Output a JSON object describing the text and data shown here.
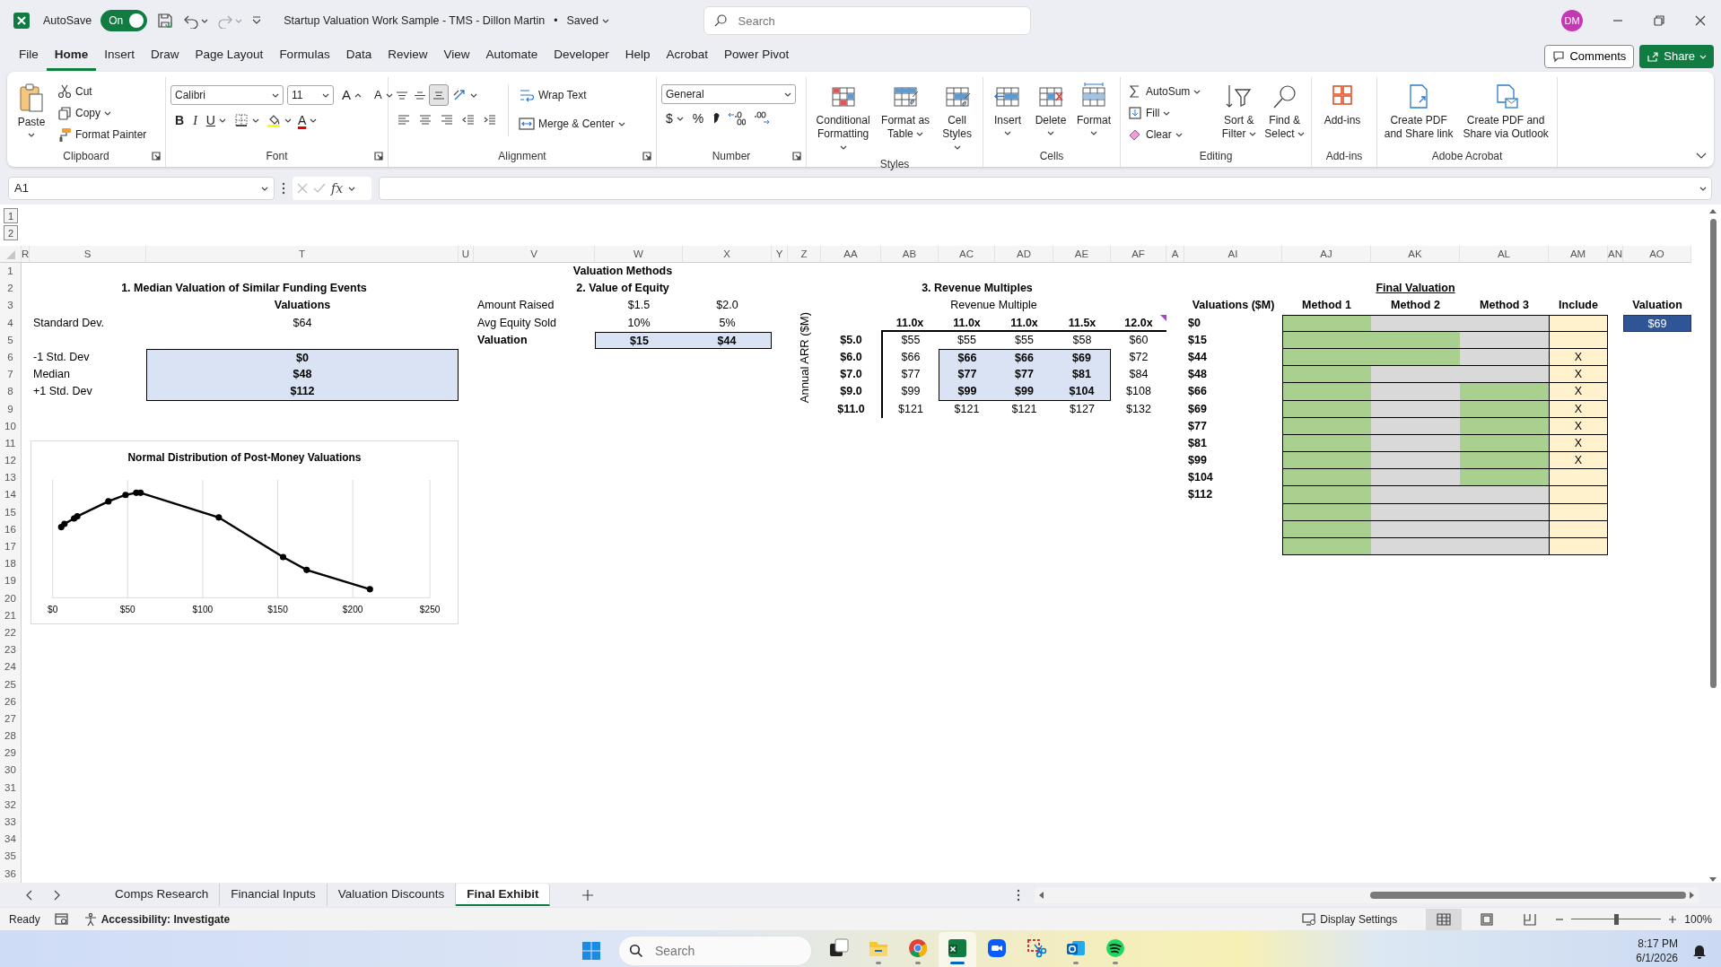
{
  "title_bar": {
    "autosave_label": "AutoSave",
    "autosave": {
      "on": true,
      "label": "On"
    },
    "document_title": "Startup Valuation Work Sample - TMS - Dillon Martin",
    "separator": "•",
    "save_status": "Saved",
    "search_placeholder": "Search",
    "user_initials": "DM"
  },
  "menu_tabs": [
    {
      "label": "File",
      "selected": false
    },
    {
      "label": "Home",
      "selected": true
    },
    {
      "label": "Insert",
      "selected": false
    },
    {
      "label": "Draw",
      "selected": false
    },
    {
      "label": "Page Layout",
      "selected": false
    },
    {
      "label": "Formulas",
      "selected": false
    },
    {
      "label": "Data",
      "selected": false
    },
    {
      "label": "Review",
      "selected": false
    },
    {
      "label": "View",
      "selected": false
    },
    {
      "label": "Automate",
      "selected": false
    },
    {
      "label": "Developer",
      "selected": false
    },
    {
      "label": "Help",
      "selected": false
    },
    {
      "label": "Acrobat",
      "selected": false
    },
    {
      "label": "Power Pivot",
      "selected": false
    }
  ],
  "comments_button": "Comments",
  "share_button": "Share",
  "ribbon": {
    "clipboard": {
      "label": "Clipboard",
      "paste": "Paste",
      "cut": "Cut",
      "copy": "Copy",
      "format_painter": "Format Painter"
    },
    "font": {
      "label": "Font",
      "font_name": "Calibri",
      "font_size": "11",
      "grow": "A",
      "shrink": "A",
      "bold": "B",
      "italic": "I",
      "underline": "U",
      "font_color": "A"
    },
    "alignment": {
      "label": "Alignment",
      "vertical_alignment": [
        {
          "selected": false
        },
        {
          "selected": false
        },
        {
          "selected": true
        }
      ],
      "wrap_text": "Wrap Text",
      "merge_center": "Merge & Center"
    },
    "number": {
      "label": "Number",
      "format": "General",
      "currency": "$",
      "percent": "%"
    },
    "styles": {
      "label": "Styles",
      "buttons": [
        "Conditional Formatting",
        "Format as Table",
        "Cell Styles"
      ]
    },
    "cells": {
      "label": "Cells",
      "buttons": [
        "Insert",
        "Delete",
        "Format"
      ]
    },
    "editing": {
      "label": "Editing",
      "autosum": "AutoSum",
      "fill": "Fill",
      "clear": "Clear",
      "buttons": [
        "Sort & Filter",
        "Find & Select"
      ]
    },
    "addins": {
      "label": "Add-ins",
      "buttons": [
        "Add-ins"
      ]
    },
    "acrobat": {
      "label": "Adobe Acrobat",
      "buttons": [
        "Create PDF and Share link",
        "Create PDF and Share via Outlook"
      ]
    }
  },
  "formula_bar": {
    "name_box": "A1",
    "function_button": "fx"
  },
  "outline_levels": [
    "1",
    "2"
  ],
  "column_headers": [
    "R",
    "S",
    "T",
    "U",
    "V",
    "W",
    "X",
    "Y",
    "Z",
    "AA",
    "AB",
    "AC",
    "AD",
    "AE",
    "AF",
    "A",
    "AI",
    "AJ",
    "AK",
    "AL",
    "AM",
    "AN",
    "AO"
  ],
  "row_headers": [
    "1",
    "2",
    "3",
    "4",
    "5",
    "6",
    "7",
    "8",
    "9",
    "10",
    "11",
    "12",
    "13",
    "14",
    "15",
    "16",
    "17",
    "18",
    "19",
    "20",
    "21",
    "22",
    "23",
    "24",
    "25",
    "26",
    "27",
    "28",
    "29",
    "30",
    "31",
    "32",
    "33",
    "34",
    "35",
    "36"
  ],
  "sheet": {
    "section_title": "Valuation Methods",
    "median": {
      "title": "1. Median Valuation of Similar Funding Events",
      "column_header": "Valuations",
      "std_dev_label": "Standard Dev.",
      "std_dev_value": "$64",
      "rows": [
        {
          "label": "-1 Std. Dev",
          "value": "$0",
          "highlighted": true
        },
        {
          "label": "Median",
          "value": "$48",
          "highlighted": true
        },
        {
          "label": "+1 Std. Dev",
          "value": "$112",
          "highlighted": true
        }
      ]
    },
    "chart": {
      "title": "Normal Distribution of Post-Money Valuations",
      "x_tick_labels": [
        "$0",
        "$50",
        "$100",
        "$150",
        "$200",
        "$250"
      ]
    },
    "equity": {
      "title": "2. Value of Equity",
      "rows": [
        {
          "label": "Amount Raised",
          "values": [
            "$1.5",
            "$2.0"
          ],
          "highlighted": false
        },
        {
          "label": "Avg Equity Sold",
          "values": [
            "10%",
            "5%"
          ],
          "highlighted": false
        },
        {
          "label": "Valuation",
          "values": [
            "$15",
            "$44"
          ],
          "highlighted": true
        }
      ]
    },
    "revenue": {
      "title": "3. Revenue Multiples",
      "column_title": "Revenue Multiple",
      "row_title": "Annual ARR ($M)",
      "has_comment": true,
      "multiples": [
        "11.0x",
        "11.0x",
        "11.0x",
        "11.5x",
        "12.0x"
      ],
      "rows": [
        {
          "arr": "$5.0",
          "values": [
            "$55",
            "$55",
            "$55",
            "$58",
            "$60"
          ],
          "highlighted": [
            false,
            false,
            false,
            false,
            false
          ]
        },
        {
          "arr": "$6.0",
          "values": [
            "$66",
            "$66",
            "$66",
            "$69",
            "$72"
          ],
          "highlighted": [
            false,
            true,
            true,
            true,
            false
          ]
        },
        {
          "arr": "$7.0",
          "values": [
            "$77",
            "$77",
            "$77",
            "$81",
            "$84"
          ],
          "highlighted": [
            false,
            true,
            true,
            true,
            false
          ]
        },
        {
          "arr": "$9.0",
          "values": [
            "$99",
            "$99",
            "$99",
            "$104",
            "$108"
          ],
          "highlighted": [
            false,
            true,
            true,
            true,
            false
          ]
        },
        {
          "arr": "$11.0",
          "values": [
            "$121",
            "$121",
            "$121",
            "$127",
            "$132"
          ],
          "highlighted": [
            false,
            false,
            false,
            false,
            false
          ]
        }
      ]
    },
    "final": {
      "title": "Final Valuation",
      "headers": [
        "Valuations ($M)",
        "Method 1",
        "Method 2",
        "Method 3",
        "Include"
      ],
      "result_header": "Valuation",
      "result": "$69",
      "rows": [
        {
          "valuation": "$0",
          "methods": [
            true,
            false,
            false
          ],
          "included": false
        },
        {
          "valuation": "$15",
          "methods": [
            true,
            true,
            false
          ],
          "included": false
        },
        {
          "valuation": "$44",
          "methods": [
            true,
            true,
            false
          ],
          "included": true,
          "mark": "X"
        },
        {
          "valuation": "$48",
          "methods": [
            true,
            false,
            false
          ],
          "included": true,
          "mark": "X"
        },
        {
          "valuation": "$66",
          "methods": [
            true,
            false,
            true
          ],
          "included": true,
          "mark": "X"
        },
        {
          "valuation": "$69",
          "methods": [
            true,
            false,
            true
          ],
          "included": true,
          "mark": "X"
        },
        {
          "valuation": "$77",
          "methods": [
            true,
            false,
            true
          ],
          "included": true,
          "mark": "X"
        },
        {
          "valuation": "$81",
          "methods": [
            true,
            false,
            true
          ],
          "included": true,
          "mark": "X"
        },
        {
          "valuation": "$99",
          "methods": [
            true,
            false,
            true
          ],
          "included": true,
          "mark": "X"
        },
        {
          "valuation": "$104",
          "methods": [
            true,
            false,
            true
          ],
          "included": false
        },
        {
          "valuation": "$112",
          "methods": [
            true,
            false,
            false
          ],
          "included": false
        },
        {
          "methods": [
            true,
            false,
            false
          ],
          "included": false
        },
        {
          "methods": [
            true,
            false,
            false
          ],
          "included": false
        },
        {
          "methods": [
            true,
            false,
            false
          ],
          "included": false
        }
      ]
    }
  },
  "sheet_tabs": [
    {
      "label": "Comps Research",
      "selected": false
    },
    {
      "label": "Financial Inputs",
      "selected": false
    },
    {
      "label": "Valuation Discounts",
      "selected": false
    },
    {
      "label": "Final Exhibit",
      "selected": true
    }
  ],
  "status_bar": {
    "ready": "Ready",
    "accessibility": "Accessibility: Investigate",
    "display_settings": "Display Settings",
    "views": [
      {
        "selected": true
      },
      {
        "selected": false
      },
      {
        "selected": false
      }
    ],
    "zoom": {
      "level": 0.5
    },
    "zoom_percent": "100%"
  },
  "taskbar": {
    "search_placeholder": "Search",
    "apps": [
      {
        "running": false,
        "selected": false
      },
      {
        "running": true,
        "selected": false
      },
      {
        "running": true,
        "selected": false
      },
      {
        "running": true,
        "selected": true
      },
      {
        "running": false,
        "selected": false
      },
      {
        "running": false,
        "selected": false
      },
      {
        "running": true,
        "selected": false
      },
      {
        "running": true,
        "selected": false
      }
    ],
    "time": "8:17 PM",
    "date": "6/1/2026"
  }
}
